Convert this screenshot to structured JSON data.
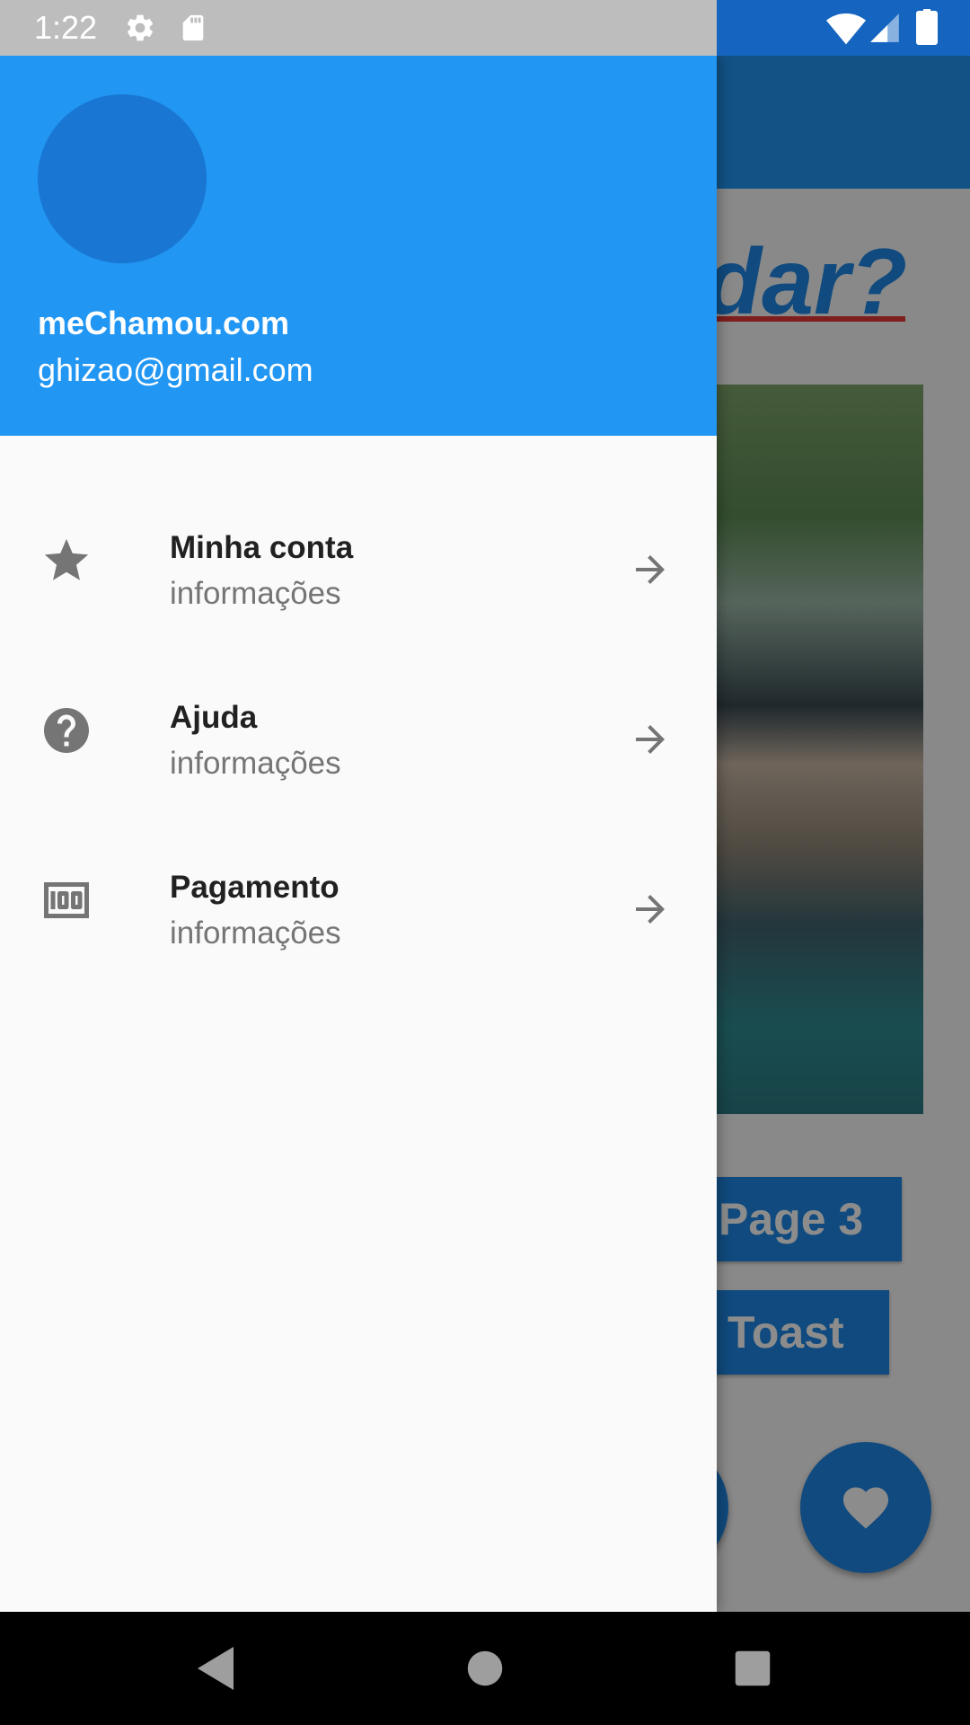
{
  "status_bar": {
    "time": "1:22",
    "icons": [
      "settings-icon",
      "sd-card-icon",
      "wifi-icon",
      "signal-icon",
      "battery-icon"
    ]
  },
  "drawer": {
    "header": {
      "account_name": "meChamou.com",
      "account_email": "ghizao@gmail.com",
      "color": "#2196f3",
      "avatar_color": "#1976d2"
    },
    "items": [
      {
        "icon": "star-icon",
        "title": "Minha conta",
        "subtitle": "informações"
      },
      {
        "icon": "help-icon",
        "title": "Ajuda",
        "subtitle": "informações"
      },
      {
        "icon": "money-icon",
        "title": "Pagamento",
        "subtitle": "informações"
      }
    ]
  },
  "background_screen": {
    "heading_fragment": "udar?",
    "buttons": [
      "Page 3",
      "Toast"
    ],
    "fab_icon": "heart-icon",
    "accent": "#1e88e5"
  },
  "nav_bar": {
    "buttons": [
      "back-icon",
      "home-icon",
      "recents-icon"
    ]
  }
}
